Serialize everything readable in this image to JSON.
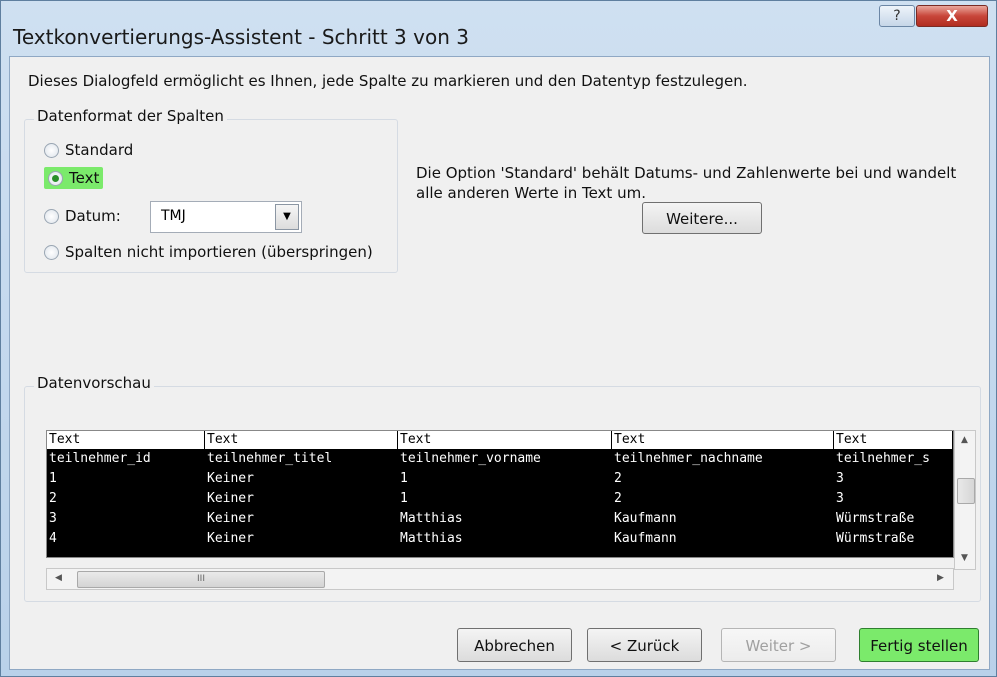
{
  "window": {
    "title": "Textkonvertierungs-Assistent - Schritt 3 von 3",
    "help_label": "?",
    "close_label": "X"
  },
  "intro_text": "Dieses Dialogfeld ermöglicht es Ihnen, jede Spalte zu markieren und den Datentyp festzulegen.",
  "format_group": {
    "label": "Datenformat der Spalten",
    "options": [
      {
        "label": "Standard",
        "checked": false
      },
      {
        "label": "Text",
        "checked": true
      },
      {
        "label": "Datum:",
        "checked": false
      },
      {
        "label": "Spalten nicht importieren (überspringen)",
        "checked": false
      }
    ],
    "date_select_value": "TMJ"
  },
  "info_text": "Die Option 'Standard' behält Datums- und Zahlenwerte bei und wandelt alle anderen Werte in Text um.",
  "more_button": "Weitere...",
  "preview": {
    "label": "Datenvorschau",
    "columns": [
      {
        "header": "Text",
        "cells": [
          "teilnehmer_id",
          "1",
          "2",
          "3",
          "4"
        ]
      },
      {
        "header": "Text",
        "cells": [
          "teilnehmer_titel",
          "Keiner",
          "Keiner",
          "Keiner",
          "Keiner"
        ]
      },
      {
        "header": "Text",
        "cells": [
          "teilnehmer_vorname",
          "1",
          "1",
          "Matthias",
          "Matthias"
        ]
      },
      {
        "header": "Text",
        "cells": [
          "teilnehmer_nachname",
          "2",
          "2",
          "Kaufmann",
          "Kaufmann"
        ]
      },
      {
        "header": "Text",
        "cells": [
          "teilnehmer_s",
          "3",
          "3",
          "Würmstraße",
          "Würmstraße"
        ]
      }
    ],
    "hscroll_label": "III"
  },
  "buttons": {
    "cancel": "Abbrechen",
    "back": "< Zurück",
    "next": "Weiter >",
    "finish": "Fertig stellen"
  }
}
